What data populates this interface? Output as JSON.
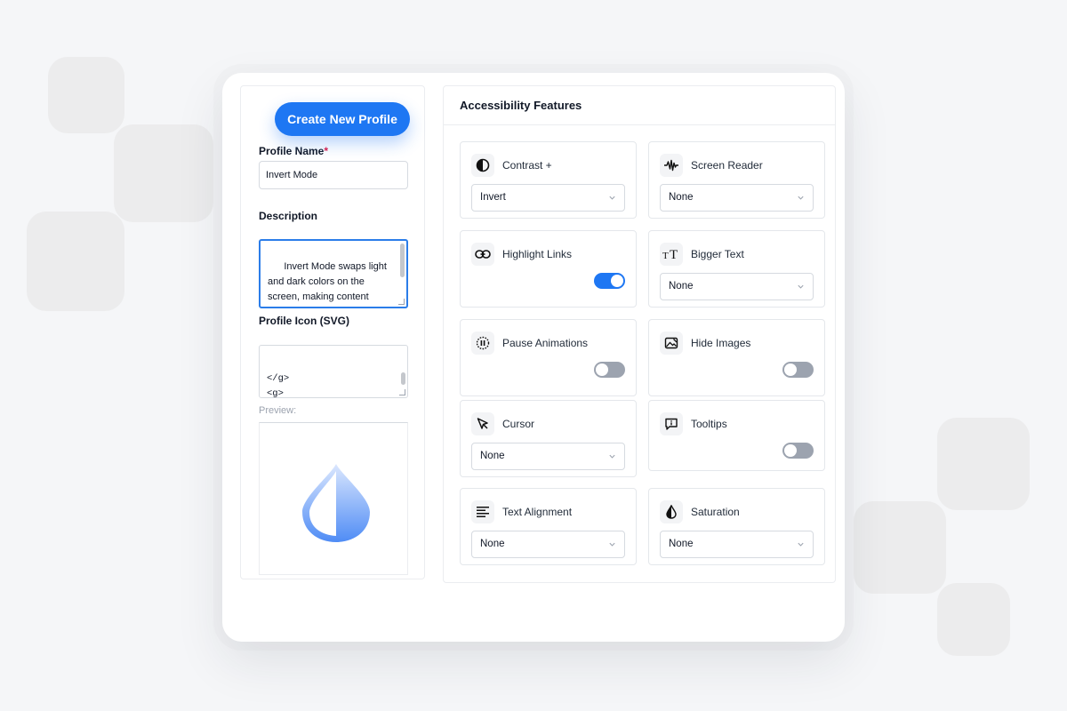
{
  "colors": {
    "accent": "#1e77f3",
    "toggle_off": "#9ca3af",
    "required": "#e11d48",
    "icon_gradient_start": "#dbe7fe",
    "icon_gradient_end": "#4f8cf5"
  },
  "profile_form": {
    "create_button_label": "Create New Profile",
    "name_label": "Profile Name",
    "name_required_mark": "*",
    "name_value": "Invert Mode",
    "description_label": "Description",
    "description_value": "Invert Mode swaps light\nand dark colors on the\nscreen, making content\neasier to view in different",
    "icon_label": "Profile Icon (SVG)",
    "icon_svg_value": "</g>\n<g>\n</g>\n</svg>",
    "preview_label": "Preview:",
    "preview_icon": "drop-half-icon"
  },
  "features": {
    "header": "Accessibility Features",
    "items": [
      {
        "title": "Contrast +",
        "icon": "contrast-icon",
        "control": "select",
        "value": "Invert"
      },
      {
        "title": "Screen Reader",
        "icon": "waveform-icon",
        "control": "select",
        "value": "None"
      },
      {
        "title": "Highlight Links",
        "icon": "link-icon",
        "control": "toggle",
        "on": true
      },
      {
        "title": "Bigger Text",
        "icon": "text-size-icon",
        "control": "select",
        "value": "None"
      },
      {
        "title": "Pause Animations",
        "icon": "pause-circle-icon",
        "control": "toggle",
        "on": false
      },
      {
        "title": "Hide Images",
        "icon": "hide-image-icon",
        "control": "toggle",
        "on": false
      },
      {
        "title": "Cursor",
        "icon": "cursor-icon",
        "control": "select",
        "value": "None"
      },
      {
        "title": "Tooltips",
        "icon": "tooltip-icon",
        "control": "toggle",
        "on": false
      },
      {
        "title": "Text Alignment",
        "icon": "align-left-icon",
        "control": "select",
        "value": "None"
      },
      {
        "title": "Saturation",
        "icon": "drop-icon",
        "control": "select",
        "value": "None"
      }
    ]
  }
}
